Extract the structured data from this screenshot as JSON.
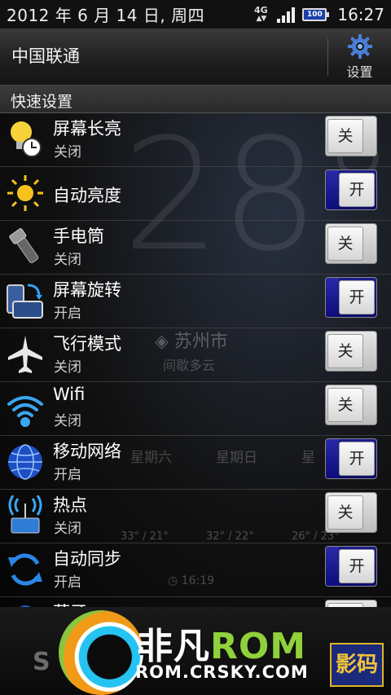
{
  "status_bar": {
    "date": "2012 年 6 月 14 日, 周四",
    "network": "4G",
    "battery": "100",
    "time": "16:27"
  },
  "header": {
    "carrier": "中国联通",
    "settings_label": "设置"
  },
  "quick_settings": {
    "title": "快速设置",
    "items": [
      {
        "label": "屏幕长亮",
        "status": "关闭",
        "toggle": "关",
        "state": "off",
        "icon": "bulb-clock-icon"
      },
      {
        "label": "自动亮度",
        "status": "",
        "toggle": "开",
        "state": "on",
        "icon": "sun-icon"
      },
      {
        "label": "手电筒",
        "status": "关闭",
        "toggle": "关",
        "state": "off",
        "icon": "flashlight-icon"
      },
      {
        "label": "屏幕旋转",
        "status": "开启",
        "toggle": "开",
        "state": "on",
        "icon": "screen-rotate-icon"
      },
      {
        "label": "飞行模式",
        "status": "关闭",
        "toggle": "关",
        "state": "off",
        "icon": "airplane-icon"
      },
      {
        "label": "Wifi",
        "status": "关闭",
        "toggle": "关",
        "state": "off",
        "icon": "wifi-icon"
      },
      {
        "label": "移动网络",
        "status": "开启",
        "toggle": "开",
        "state": "on",
        "icon": "globe-icon"
      },
      {
        "label": "热点",
        "status": "关闭",
        "toggle": "关",
        "state": "off",
        "icon": "hotspot-icon"
      },
      {
        "label": "自动同步",
        "status": "开启",
        "toggle": "开",
        "state": "on",
        "icon": "sync-icon"
      },
      {
        "label": "蓝牙",
        "status": "",
        "toggle": "关",
        "state": "off",
        "icon": "bluetooth-icon"
      }
    ]
  },
  "weather_background": {
    "temperature": "28°C",
    "city": "苏州市",
    "condition": "间歇多云",
    "days": [
      "星期六",
      "星期日",
      "星"
    ],
    "ranges": [
      "33° / 21°",
      "32° / 22°",
      "26° / 23°"
    ],
    "clock": "16:19"
  },
  "watermark": {
    "brand_cn": "非凡",
    "brand_en": "ROM",
    "url": "ROM.CRSKY.COM",
    "right_logo": "影码"
  },
  "colors": {
    "toggle_on": "#0b0b6a",
    "settings_gear": "#4a7fd6",
    "brand_green": "#8fd13b"
  }
}
